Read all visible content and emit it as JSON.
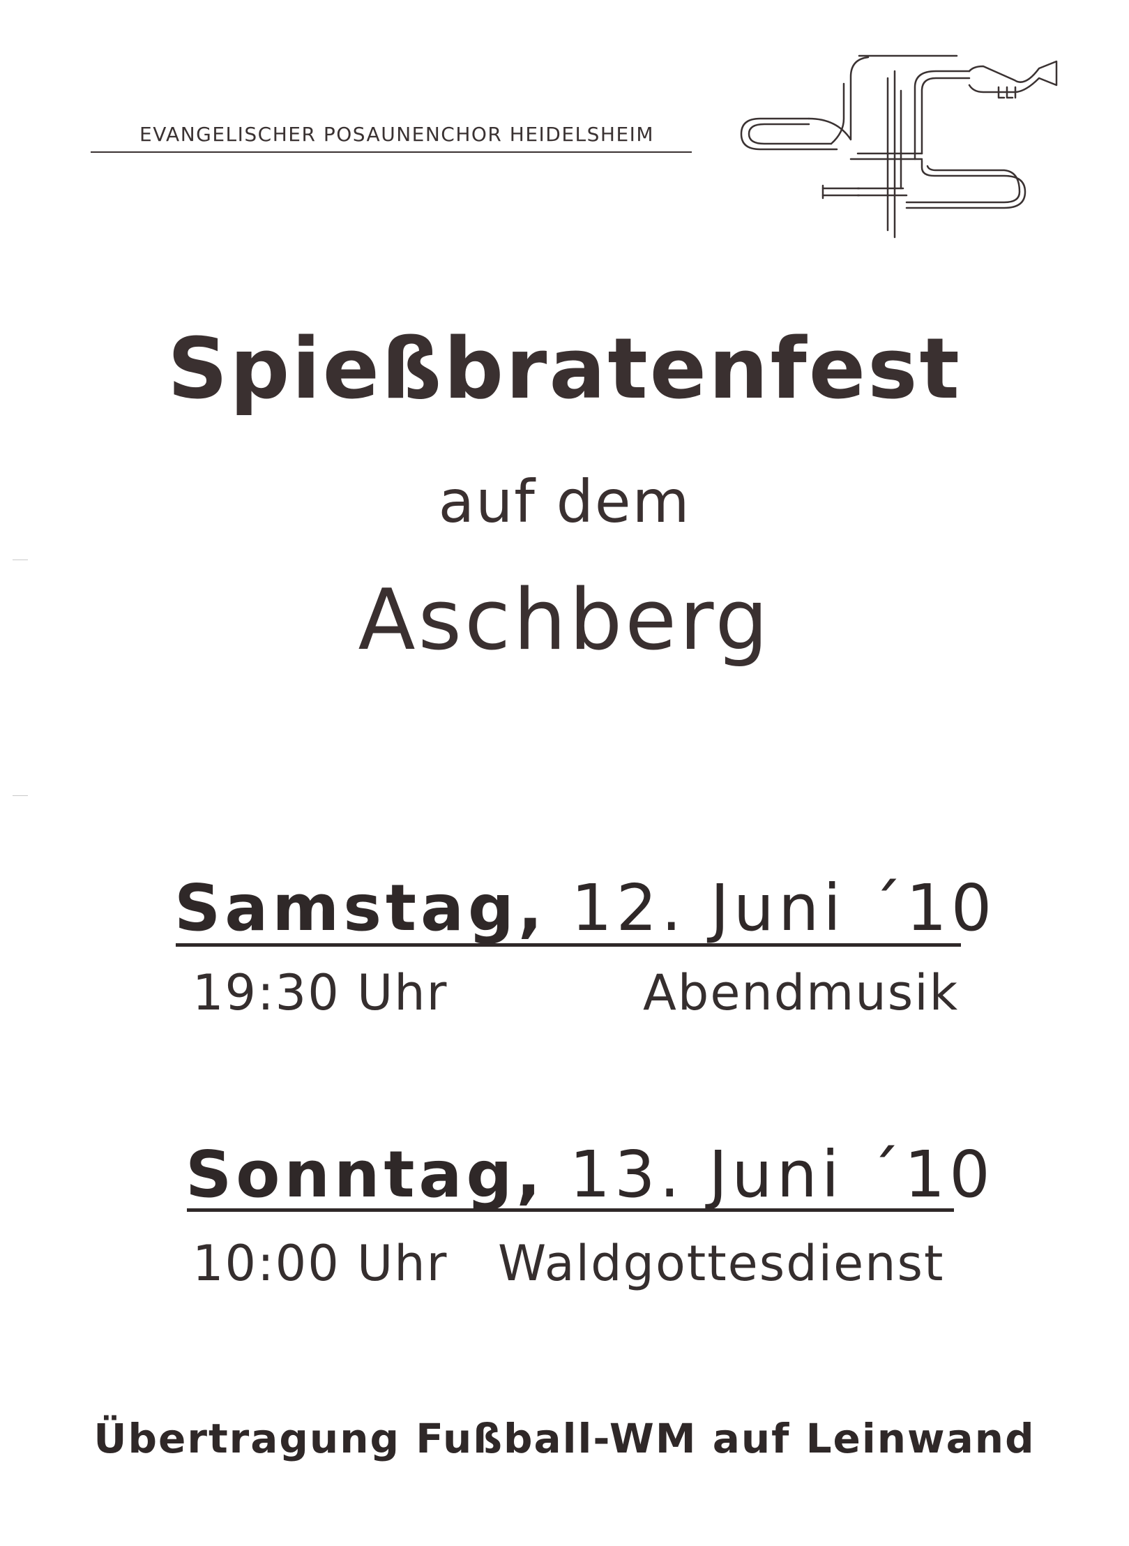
{
  "header": {
    "organization": "EVANGELISCHER POSAUNENCHOR HEIDELSHEIM",
    "logo_icon": "brass-instruments-logo-icon"
  },
  "title": {
    "main": "Spießbratenfest",
    "sub": "auf dem",
    "place": "Aschberg"
  },
  "schedule": [
    {
      "day": "Samstag,",
      "date": "12. Juni ´10",
      "time": "19:30 Uhr",
      "event": "Abendmusik"
    },
    {
      "day": "Sonntag,",
      "date": "13. Juni ´10",
      "time": "10:00 Uhr",
      "event": "Waldgottesdienst"
    }
  ],
  "footer": {
    "note": "Übertragung Fußball-WM auf Leinwand"
  },
  "colors": {
    "ink": "#2f2828",
    "paper": "#ffffff"
  }
}
